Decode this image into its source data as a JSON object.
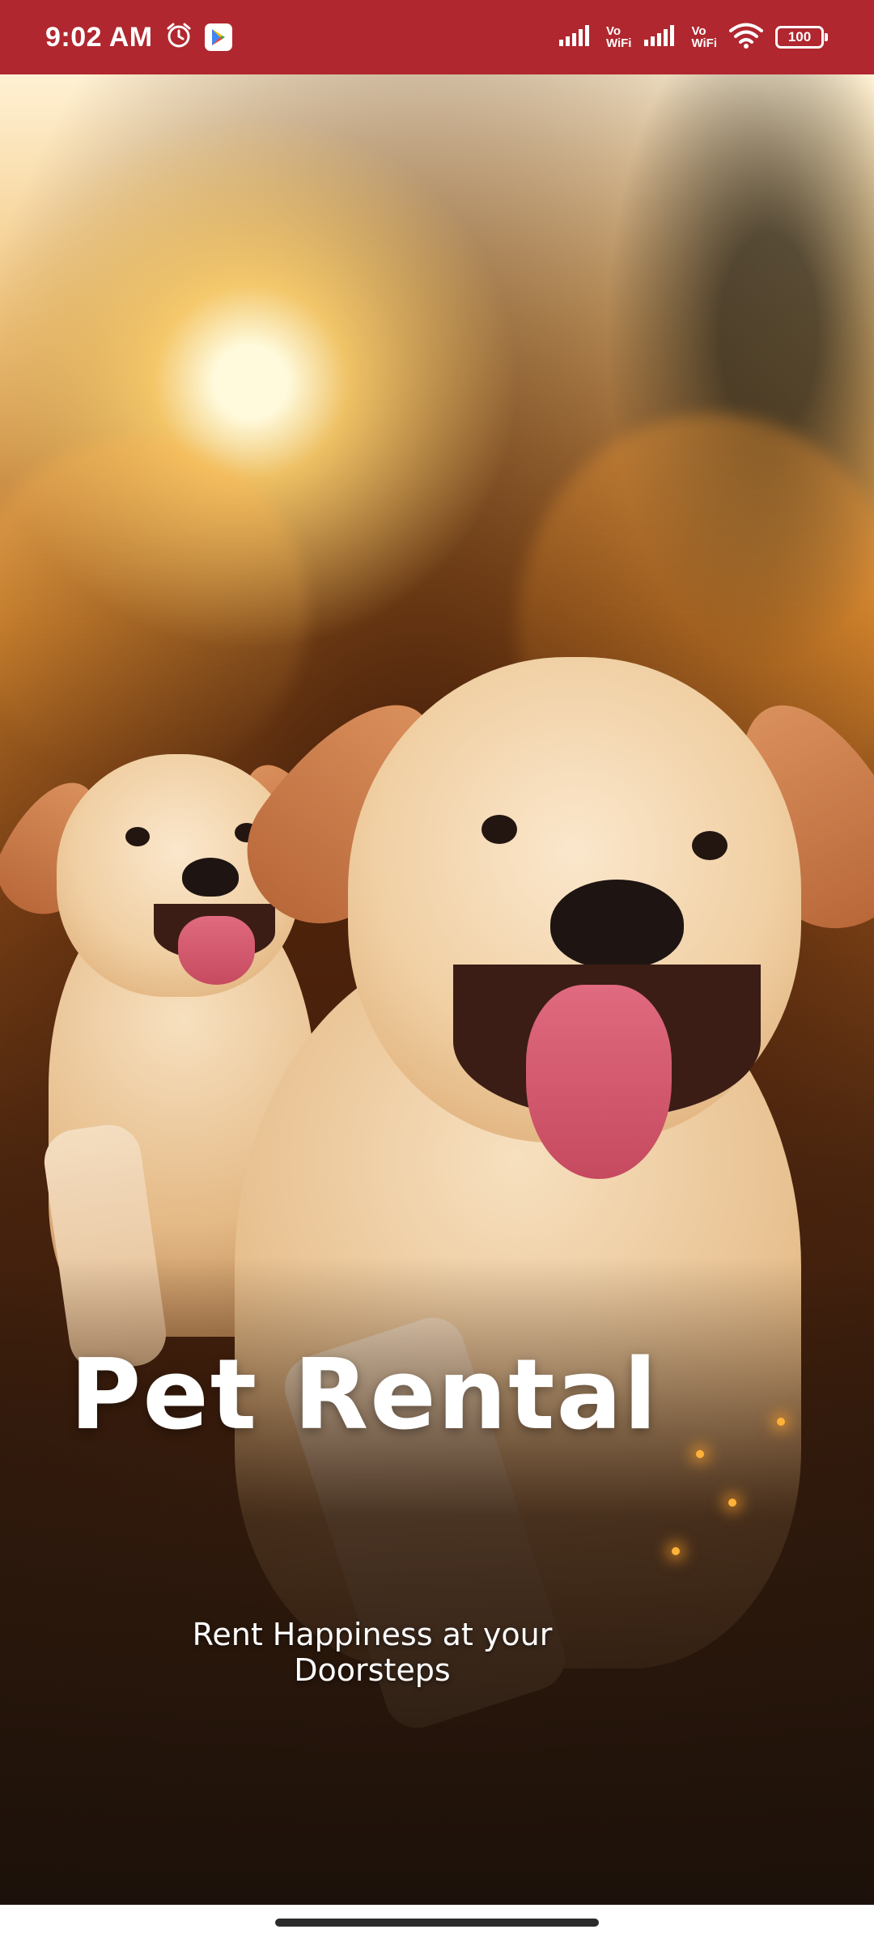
{
  "status_bar": {
    "time": "9:02 AM",
    "alarm_icon": "alarm-clock-icon",
    "app_icon": "play-store-icon",
    "sim1_label_top": "Vo",
    "sim1_label_bottom": "WiFi",
    "sim2_label_top": "Vo",
    "sim2_label_bottom": "WiFi",
    "wifi_icon": "wifi-icon",
    "battery_level": "100",
    "background_color": "#b0272f"
  },
  "splash": {
    "title": "Pet Rental",
    "tagline_line1": "Rent Happiness at your",
    "tagline_line2": "Doorsteps",
    "image_subject": "two puppies running through a field at sunset"
  },
  "navigation": {
    "indicator": "home-indicator"
  }
}
